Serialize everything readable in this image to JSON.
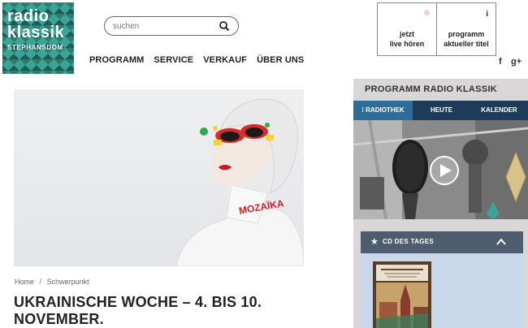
{
  "logo": {
    "line1": "radio",
    "line2": "klassik",
    "line3": "STEPHANSDOM"
  },
  "search": {
    "placeholder": "suchen"
  },
  "nav": [
    "PROGRAMM",
    "SERVICE",
    "VERKAUF",
    "ÜBER UNS"
  ],
  "live": {
    "line1": "jetzt",
    "line2": "live hören"
  },
  "programm": {
    "line1": "programm",
    "line2": "aktueller titel",
    "info": "i"
  },
  "social": {
    "facebook": "f",
    "google": "g+"
  },
  "hero": {
    "text": "MOZAÏKA"
  },
  "breadcrumb": [
    "Home",
    "/",
    "Schwerpunkt"
  ],
  "headline": "UKRAINISCHE WOCHE – 4. BIS 10. NOVEMBER.",
  "sidebar": {
    "title": "PROGRAMM RADIO KLASSIK",
    "tabs": [
      "RADIOTHEK",
      "HEUTE",
      "KALENDER"
    ],
    "cd_label": "CD DES TAGES"
  },
  "colors": {
    "tabs_bg": "#1e3c5a",
    "tab_active": "#2e6d95",
    "panel_bg": "#d9d6d7",
    "cd_bar": "#4d5d6f",
    "cd_panel": "#c8d8ea"
  },
  "icons": {
    "search": "search-icon",
    "chevron": "chevron-up-icon",
    "star": "star-icon",
    "play": "play-icon"
  }
}
